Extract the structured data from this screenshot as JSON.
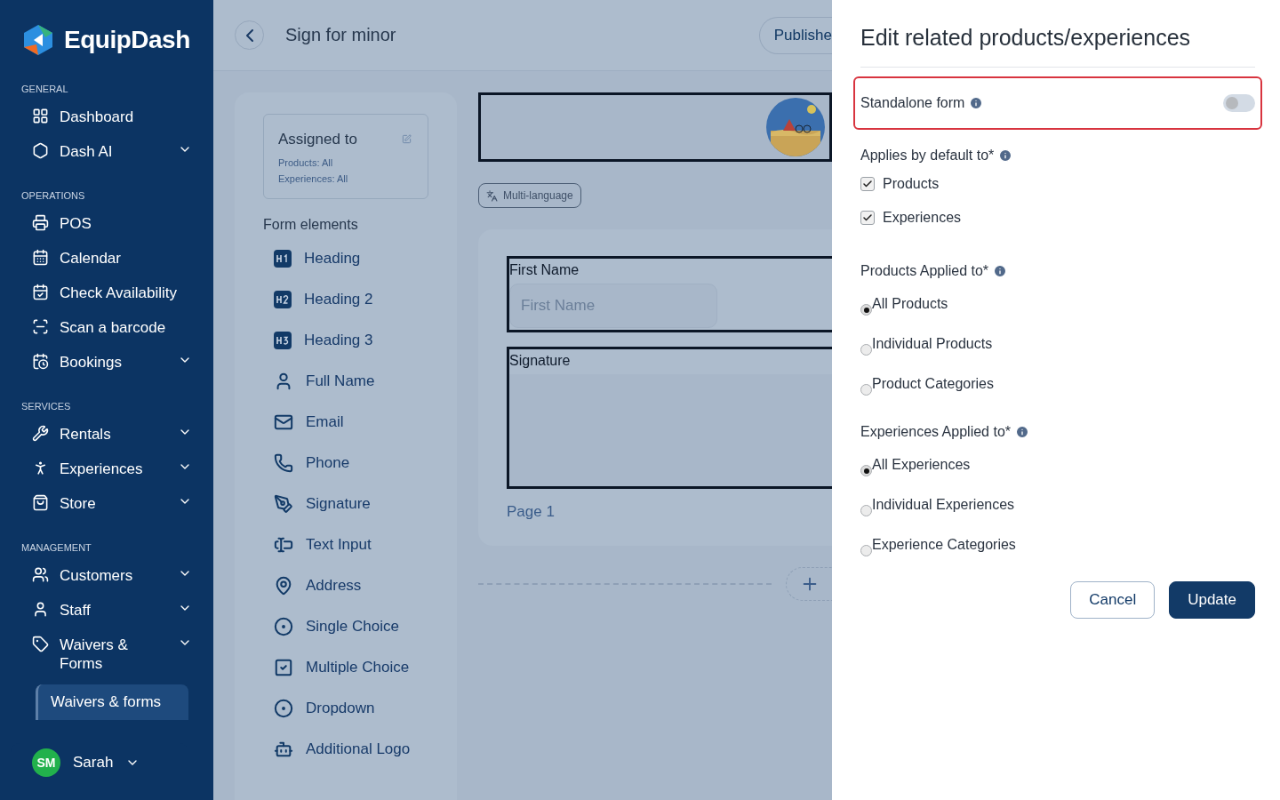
{
  "brand": "EquipDash",
  "sidebar": {
    "sections": [
      {
        "title": "GENERAL",
        "items": [
          {
            "label": "Dashboard",
            "expandable": false
          },
          {
            "label": "Dash AI",
            "expandable": true
          }
        ]
      },
      {
        "title": "OPERATIONS",
        "items": [
          {
            "label": "POS",
            "expandable": false
          },
          {
            "label": "Calendar",
            "expandable": false
          },
          {
            "label": "Check Availability",
            "expandable": false
          },
          {
            "label": "Scan a barcode",
            "expandable": false
          },
          {
            "label": "Bookings",
            "expandable": true
          }
        ]
      },
      {
        "title": "SERVICES",
        "items": [
          {
            "label": "Rentals",
            "expandable": true
          },
          {
            "label": "Experiences",
            "expandable": true
          },
          {
            "label": "Store",
            "expandable": true
          }
        ]
      },
      {
        "title": "MANAGEMENT",
        "items": [
          {
            "label": "Customers",
            "expandable": true
          },
          {
            "label": "Staff",
            "expandable": true
          },
          {
            "label": "Waivers & Forms",
            "expandable": true,
            "children": [
              {
                "label": "Waivers & forms",
                "selected": true
              }
            ]
          }
        ]
      }
    ],
    "user": {
      "initials": "SM",
      "name": "Sarah"
    }
  },
  "header": {
    "title": "Sign for minor",
    "status_button": "Publishe"
  },
  "assigned": {
    "title": "Assigned to",
    "lines": [
      "Products: All",
      "Experiences: All"
    ]
  },
  "form_elements": {
    "title": "Form elements",
    "items": [
      {
        "label": "Heading"
      },
      {
        "label": "Heading 2"
      },
      {
        "label": "Heading 3"
      },
      {
        "label": "Full Name"
      },
      {
        "label": "Email"
      },
      {
        "label": "Phone"
      },
      {
        "label": "Signature"
      },
      {
        "label": "Text Input"
      },
      {
        "label": "Address"
      },
      {
        "label": "Single Choice"
      },
      {
        "label": "Multiple Choice"
      },
      {
        "label": "Dropdown"
      },
      {
        "label": "Additional Logo"
      }
    ]
  },
  "canvas": {
    "language_chip": "Multi-language",
    "fields": [
      {
        "kind": "input",
        "label": "First Name",
        "placeholder": "First Name"
      },
      {
        "kind": "signature",
        "label": "Signature"
      }
    ],
    "page_label": "Page 1"
  },
  "drawer": {
    "title": "Edit related products/experiences",
    "standalone": {
      "label": "Standalone form",
      "on": false
    },
    "defaults": {
      "label": "Applies by default to*",
      "options": [
        {
          "label": "Products",
          "checked": true
        },
        {
          "label": "Experiences",
          "checked": true
        }
      ]
    },
    "groups": [
      {
        "label": "Products Applied to*",
        "options": [
          {
            "label": "All Products",
            "selected": true
          },
          {
            "label": "Individual Products",
            "selected": false
          },
          {
            "label": "Product Categories",
            "selected": false
          }
        ]
      },
      {
        "label": "Experiences Applied to*",
        "options": [
          {
            "label": "All Experiences",
            "selected": true
          },
          {
            "label": "Individual Experiences",
            "selected": false
          },
          {
            "label": "Experience Categories",
            "selected": false
          }
        ]
      }
    ],
    "buttons": [
      {
        "kind": "secondary",
        "label": "Cancel"
      },
      {
        "kind": "primary",
        "label": "Update"
      }
    ]
  }
}
